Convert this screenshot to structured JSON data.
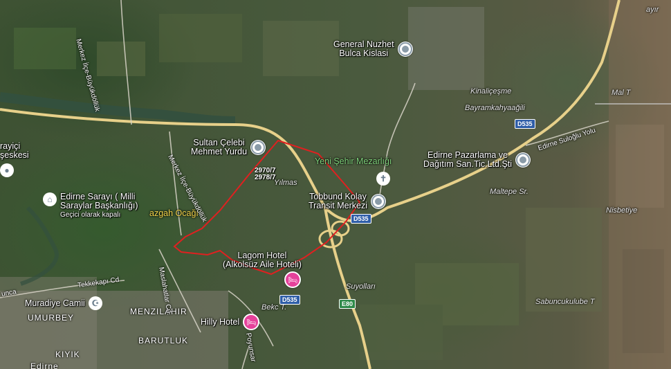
{
  "pois": [
    {
      "id": "general",
      "label": "General Nuzhet\nBulca Kislasi",
      "type": "landmark"
    },
    {
      "id": "sultan",
      "label": "Sultan Çelebi\nMehmet Yurdu",
      "type": "landmark"
    },
    {
      "id": "edirne_pazar",
      "label": "Edirne Pazarlama ve\nDağıtım San.Tic.Ltd.Şti",
      "type": "landmark"
    },
    {
      "id": "tobbund",
      "label": "Tobbund Kolay\nTransit Merkezi",
      "type": "landmark"
    },
    {
      "id": "lagom",
      "label": "Lagom Hotel\n(Alkolsüz Aile Hoteli)",
      "type": "hotel"
    },
    {
      "id": "hilly",
      "label": "Hilly Hotel",
      "type": "hotel"
    },
    {
      "id": "edirne_sarayi",
      "label": "Edirne Sarayı ( Milli\nSaraylar Başkanlığı)",
      "type": "museum",
      "sublabel": "Geçici olarak kapalı"
    },
    {
      "id": "muradiye",
      "label": "Muradiye Camii",
      "type": "mosque"
    },
    {
      "id": "sarayici",
      "label": "rayiçi\nşeskesi",
      "type": "landmark"
    }
  ],
  "cemetery": "Yeni Şehir Mezarlığı",
  "yellow_label": "azgah Ocağı",
  "places": [
    "Kinaliçeşme",
    "Bayramkahyaağili",
    "Maltepe Sr.",
    "Nisbetiye",
    "Mal T",
    "Suyolları",
    "Sabuncukulube T",
    "Bekc T.",
    "Yılmas",
    "ayır"
  ],
  "districts": [
    "UMURBEY",
    "MENZILAHIR",
    "BARUTLUK",
    "KIYIK",
    "Edirne"
  ],
  "roads": [
    "Merkez İlçe-Büyükdöllük",
    "Merkez İlçe-Büyükdöllük",
    "Maslahatlar Cd.",
    "Tekkekapı Cd",
    "Edirne Suloğlu Yolu",
    "Poyunsar",
    "unca"
  ],
  "shields": [
    "D535",
    "D535",
    "D535",
    "D535",
    "E80"
  ],
  "parcel": [
    "2970/7",
    "2978/7"
  ],
  "colors": {
    "boundary": "#e02020",
    "highway": "#e7d08a",
    "road": "#d8d4c8",
    "river": "#3d5a4a"
  }
}
